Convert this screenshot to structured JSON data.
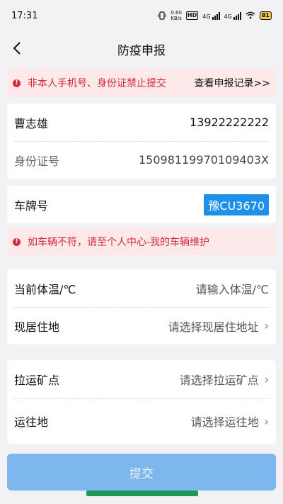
{
  "status": {
    "time": "17:31",
    "net_speed_value": "0.60",
    "net_speed_unit": "KB/s",
    "hd": "HD",
    "sim1": "4G",
    "sim2": "4G",
    "battery": "81"
  },
  "nav": {
    "title": "防疫申报"
  },
  "top_alert": {
    "message": "非本人手机号、身份证禁止提交",
    "link": "查看申报记录>>"
  },
  "identity": {
    "name": "曹志雄",
    "phone": "13922222222",
    "id_label": "身份证号",
    "id_value": "15098119970109403X"
  },
  "vehicle": {
    "label": "车牌号",
    "plate": "豫CU3670"
  },
  "vehicle_alert": {
    "message": "如车辆不符，请至个人中心-我的车辆维护"
  },
  "health": {
    "temp_label": "当前体温/℃",
    "temp_placeholder": "请输入体温/℃",
    "address_label": "现居住地",
    "address_placeholder": "请选择现居住地址"
  },
  "transport": {
    "mine_label": "拉运矿点",
    "mine_placeholder": "请选择拉运矿点",
    "dest_label": "运往地",
    "dest_placeholder": "请选择运往地"
  },
  "submit": {
    "label": "提交"
  },
  "colors": {
    "alert_bg": "#fde8ea",
    "alert_text": "#d42a3a",
    "plate_bg": "#1e90e8",
    "submit_bg": "#7db7ee",
    "home_bar": "#1f9a55"
  }
}
